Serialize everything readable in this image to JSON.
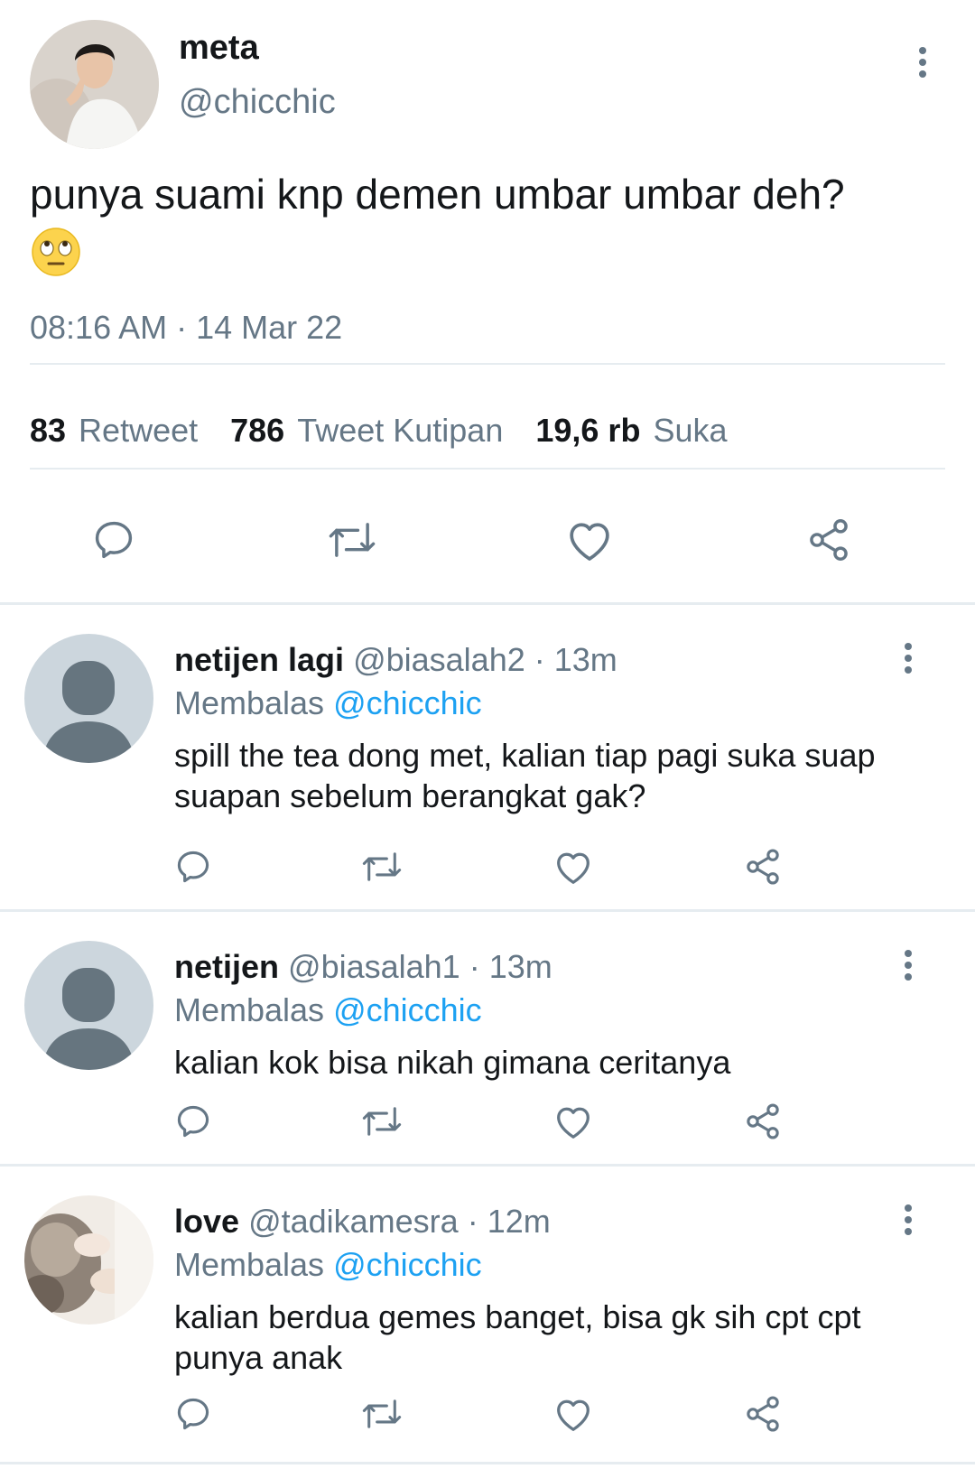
{
  "main_tweet": {
    "author_name": "meta",
    "author_handle": "@chicchic",
    "text": "punya suami knp demen umbar umbar deh?",
    "emoji": "eye-roll-emoji",
    "timestamp": "08:16 AM · 14 Mar 22",
    "stats": {
      "retweets_count": "83",
      "retweets_label": "Retweet",
      "quotes_count": "786",
      "quotes_label": "Tweet Kutipan",
      "likes_count": "19,6 rb",
      "likes_label": "Suka"
    }
  },
  "replies": [
    {
      "name": "netijen lagi",
      "handle": "@biasalah2",
      "time": "· 13m",
      "replying_prefix": "Membalas",
      "replying_to": "@chicchic",
      "text": "spill the tea dong met, kalian tiap pagi suka suap suapan sebelum berangkat gak?"
    },
    {
      "name": "netijen",
      "handle": "@biasalah1",
      "time": "· 13m",
      "replying_prefix": "Membalas",
      "replying_to": "@chicchic",
      "text": "kalian kok bisa nikah gimana ceritanya"
    },
    {
      "name": "love",
      "handle": "@tadikamesra",
      "time": "· 12m",
      "replying_prefix": "Membalas",
      "replying_to": "@chicchic",
      "text": "kalian berdua gemes banget, bisa gk sih cpt cpt punya anak"
    }
  ],
  "icons": [
    "reply-icon",
    "retweet-icon",
    "like-icon",
    "share-icon",
    "more-options-icon",
    "default-avatar-icon"
  ],
  "colors": {
    "text_primary": "#14171a",
    "text_secondary": "#657786",
    "accent": "#1da1f2",
    "divider": "#e6ecf0",
    "default_avatar_bg": "#ccd6dd",
    "default_avatar_fg": "#66757f"
  }
}
